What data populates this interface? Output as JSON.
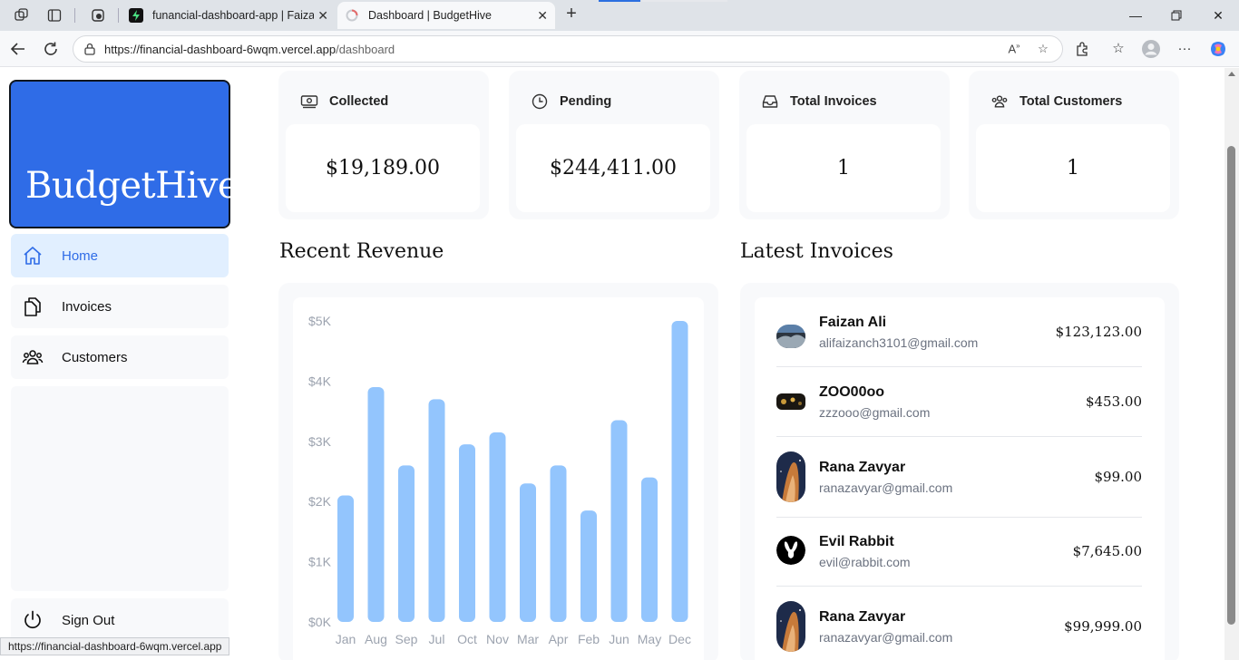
{
  "browser": {
    "tabs": [
      {
        "title": "funancial-dashboard-app | Faizan",
        "active": false
      },
      {
        "title": "Dashboard | BudgetHive",
        "active": true
      }
    ],
    "url_host": "https://financial-dashboard-6wqm.vercel.app",
    "url_path": "/dashboard",
    "status_url": "https://financial-dashboard-6wqm.vercel.app"
  },
  "sidebar": {
    "logo": "BudgetHive",
    "items": [
      {
        "label": "Home",
        "icon": "home-icon",
        "active": true
      },
      {
        "label": "Invoices",
        "icon": "document-duplicate-icon",
        "active": false
      },
      {
        "label": "Customers",
        "icon": "user-group-icon",
        "active": false
      }
    ],
    "sign_out": "Sign Out"
  },
  "cards": [
    {
      "title": "Collected",
      "value": "$19,189.00",
      "icon": "banknotes-icon"
    },
    {
      "title": "Pending",
      "value": "$244,411.00",
      "icon": "clock-icon"
    },
    {
      "title": "Total Invoices",
      "value": "1",
      "icon": "inbox-icon"
    },
    {
      "title": "Total Customers",
      "value": "1",
      "icon": "user-group-icon"
    }
  ],
  "revenue": {
    "title": "Recent Revenue"
  },
  "chart_data": {
    "type": "bar",
    "title": "Recent Revenue",
    "categories": [
      "Jan",
      "Aug",
      "Sep",
      "Jul",
      "Oct",
      "Nov",
      "Mar",
      "Apr",
      "Feb",
      "Jun",
      "May",
      "Dec"
    ],
    "values": [
      2100,
      3900,
      2600,
      3700,
      2950,
      3150,
      2300,
      2600,
      1850,
      3350,
      2400,
      5000
    ],
    "y_ticks": [
      "$5K",
      "$4K",
      "$3K",
      "$2K",
      "$1K",
      "$0K"
    ],
    "ylim": [
      0,
      5000
    ],
    "color": "#93c5fd"
  },
  "invoices": {
    "title": "Latest Invoices",
    "items": [
      {
        "name": "Faizan Ali",
        "email": "alifaizanch3101@gmail.com",
        "amount": "$123,123.00",
        "avatar": "landscape-photo"
      },
      {
        "name": "ZOO00oo",
        "email": "zzzooo@gmail.com",
        "amount": "$453.00",
        "avatar": "dark-photo"
      },
      {
        "name": "Rana Zavyar",
        "email": "ranazavyar@gmail.com",
        "amount": "$99.00",
        "avatar": "nebula-photo"
      },
      {
        "name": "Evil Rabbit",
        "email": "evil@rabbit.com",
        "amount": "$7,645.00",
        "avatar": "rabbit-logo"
      },
      {
        "name": "Rana Zavyar",
        "email": "ranazavyar@gmail.com",
        "amount": "$99,999.00",
        "avatar": "nebula-photo"
      }
    ]
  }
}
